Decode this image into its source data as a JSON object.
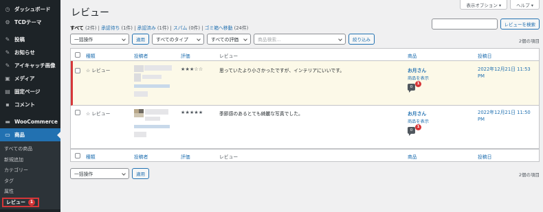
{
  "sidebar": {
    "items": [
      {
        "label": "ダッシュボード",
        "icon": "dashboard-icon"
      },
      {
        "label": "TCDテーマ",
        "icon": "gear-icon"
      },
      {
        "label": "投稿",
        "icon": "pin-icon"
      },
      {
        "label": "お知らせ",
        "icon": "pin-icon"
      },
      {
        "label": "アイキャッチ画像",
        "icon": "pin-icon"
      },
      {
        "label": "メディア",
        "icon": "media-icon"
      },
      {
        "label": "固定ページ",
        "icon": "page-icon"
      },
      {
        "label": "コメント",
        "icon": "comment-icon"
      },
      {
        "label": "WooCommerce",
        "icon": "woo-icon"
      },
      {
        "label": "商品",
        "icon": "archive-icon"
      }
    ],
    "submenu": [
      "すべての商品",
      "新規追加",
      "カテゴリー",
      "タグ",
      "属性"
    ],
    "current": {
      "label": "レビュー",
      "badge": "1"
    }
  },
  "top": {
    "screen_options": "表示オプション ▾",
    "help": "ヘルプ ▾"
  },
  "page_title": "レビュー",
  "filters": {
    "all": "すべて",
    "all_count": "(2件)",
    "pending": "承認待ち",
    "pending_count": "(1件)",
    "approved": "承認済み",
    "approved_count": "(1件)",
    "spam": "スパム",
    "spam_count": "(0件)",
    "trash": "ゴミ箱へ移動",
    "trash_count": "(24件)",
    "sep": "|"
  },
  "search": {
    "button": "レビューを検索"
  },
  "tablenav": {
    "bulk": "一括操作",
    "apply": "適用",
    "type_filter": "すべてのタイプ",
    "rating_filter": "すべての評価",
    "product_search": "商品検索...",
    "filter_button": "絞り込み",
    "count": "2個の項目"
  },
  "columns": {
    "type": "種類",
    "author": "投稿者",
    "rating": "評価",
    "review": "レビュー",
    "product": "商品",
    "date": "投稿日"
  },
  "rows": [
    {
      "type": "☆ レビュー",
      "stars": "★★★☆☆",
      "text": "思っていたより小さかったですが、インテリアにいいです。",
      "product": "お月さん",
      "product_link": "商品を表示",
      "comments": "0",
      "pending": "1",
      "date1": "2022年12月21日 11:53",
      "date2": "PM"
    },
    {
      "type": "☆ レビュー",
      "stars": "★★★★★",
      "text": "季節感のあるとても綺麗な写真でした。",
      "product": "お月さん",
      "product_link": "商品を表示",
      "comments": "0",
      "pending": "1",
      "date1": "2022年12月21日 11:50",
      "date2": "PM"
    }
  ]
}
